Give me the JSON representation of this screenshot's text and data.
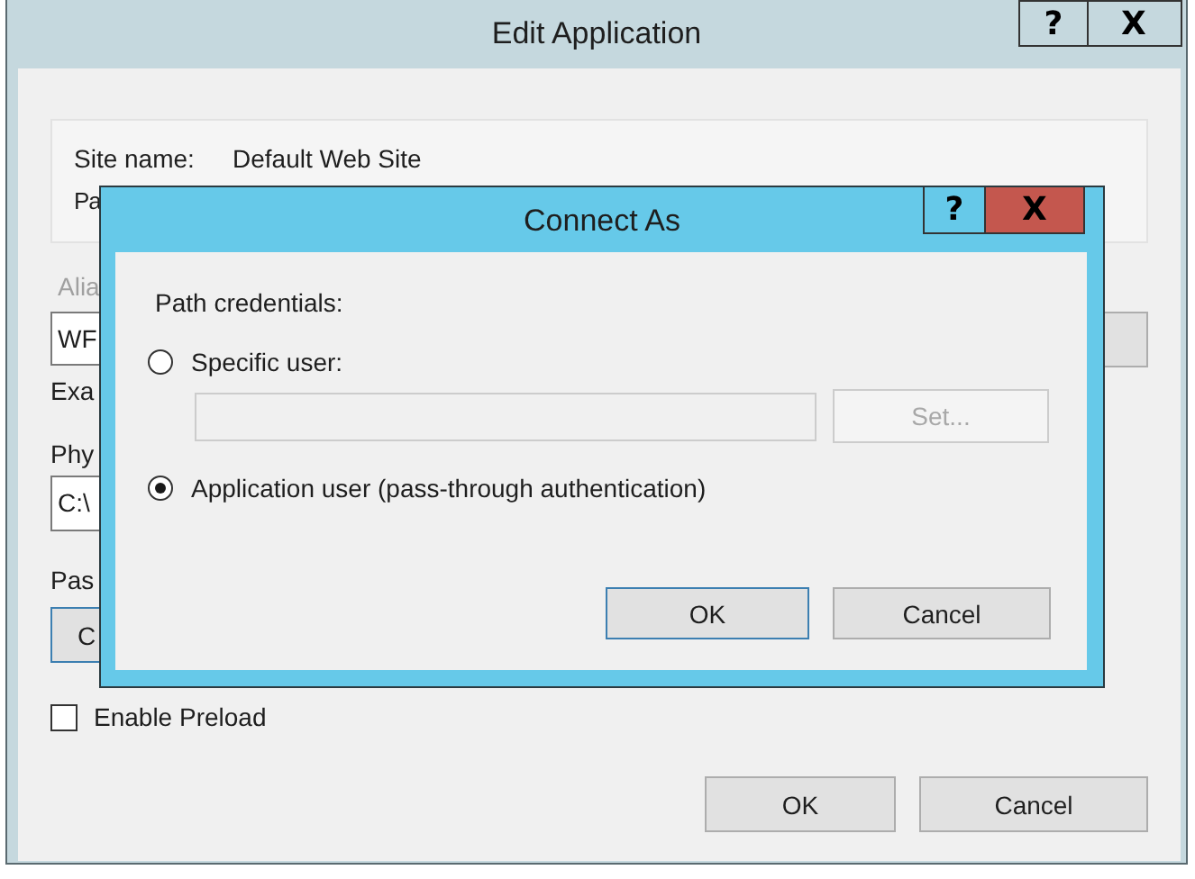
{
  "window": {
    "title": "Edit Application",
    "help_button": "?",
    "close_button": "X"
  },
  "info": {
    "site_name_label": "Site name:",
    "site_name": "Default Web Site",
    "path_label": "Pa"
  },
  "alias": {
    "label": "Alia",
    "disabled": true,
    "value": "WF"
  },
  "example_label": "Exa",
  "physical": {
    "label": "Phy",
    "value": "C:\\"
  },
  "pass": {
    "label": "Pas",
    "button": "C",
    "focused": true
  },
  "preload": {
    "label": "Enable Preload",
    "checked": false
  },
  "buttons": [
    "OK",
    "Cancel"
  ],
  "dialog": {
    "title": "Connect As",
    "help_button": "?",
    "close_button": "X",
    "group_label": "Path credentials:",
    "options": [
      {
        "label": "Specific user:",
        "selected": false
      },
      {
        "label": "Application user (pass-through authentication)",
        "selected": true
      }
    ],
    "user_field": {
      "disabled": true
    },
    "set_button": {
      "label": "Set...",
      "disabled": true
    },
    "buttons": [
      {
        "label": "OK",
        "default": true
      },
      {
        "label": "Cancel",
        "default": false
      }
    ]
  }
}
